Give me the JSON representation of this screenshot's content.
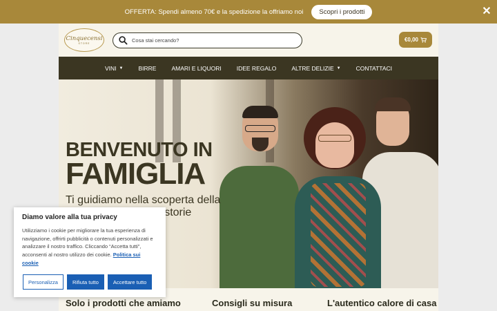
{
  "offer_bar": {
    "text": "OFFERTA: Spendi almeno 70€ e la spedizione la offriamo noi",
    "button": "Scopri i prodotti",
    "close": "✕"
  },
  "header": {
    "logo_script": "Cinquecensi",
    "logo_sub": "STORE",
    "search_placeholder": "Cosa stai cercando?",
    "cart_total": "€0,00"
  },
  "nav": {
    "items": [
      {
        "label": "VINI",
        "has_dropdown": true
      },
      {
        "label": "BIRRE",
        "has_dropdown": false
      },
      {
        "label": "AMARI E LIQUORI",
        "has_dropdown": false
      },
      {
        "label": "IDEE REGALO",
        "has_dropdown": false
      },
      {
        "label": "ALTRE DELIZIE",
        "has_dropdown": true
      },
      {
        "label": "CONTATTACI",
        "has_dropdown": false
      }
    ],
    "caret": "▼"
  },
  "hero": {
    "title_line1": "BENVENUTO IN",
    "title_line2": "FAMIGLIA",
    "subtitle": "Ti guidiamo nella scoperta della qualità, dei sapori e storie"
  },
  "features": [
    "Solo i prodotti che amiamo",
    "Consigli su misura",
    "L'autentico calore di casa"
  ],
  "cookie": {
    "title": "Diamo valore alla tua privacy",
    "text": "Utilizziamo i cookie per migliorare la tua esperienza di navigazione, offrirti pubblicità o contenuti personalizzati e analizzare il nostro traffico. Cliccando “Accetta tutti”, acconsenti al nostro utilizzo dei cookie.",
    "link": "Politica sui cookie",
    "buttons": {
      "customize": "Personalizza",
      "reject": "Rifiuta tutto",
      "accept": "Accettare tutto"
    }
  },
  "colors": {
    "gold": "#a8883a",
    "nav_dark": "#3b3622",
    "cookie_blue": "#1a5fb4"
  }
}
